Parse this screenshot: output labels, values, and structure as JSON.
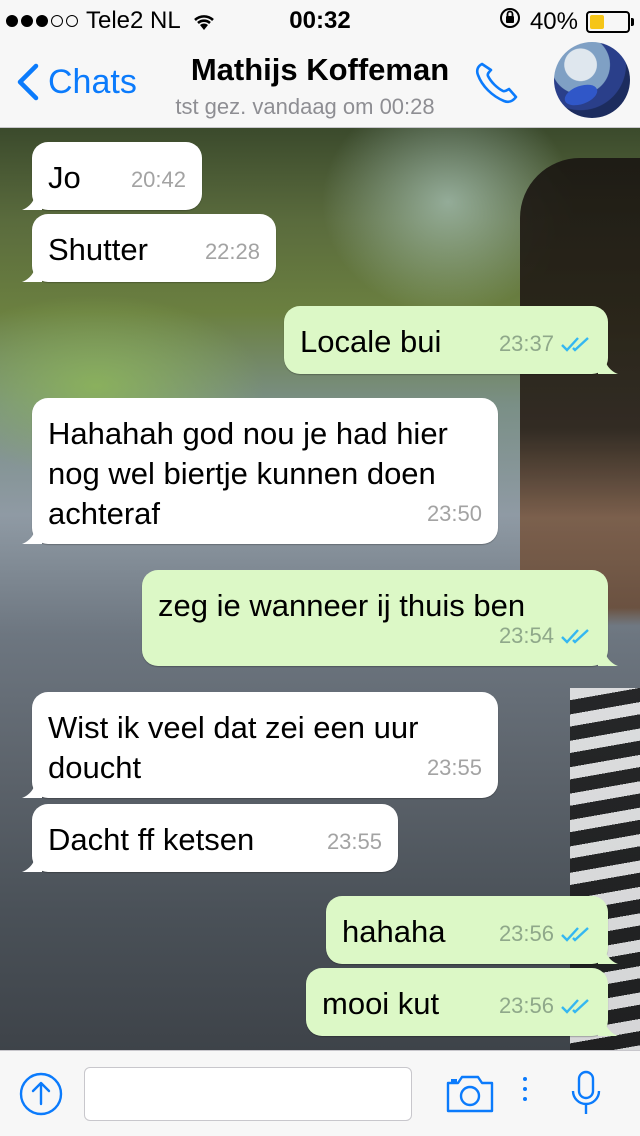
{
  "status_bar": {
    "carrier": "Tele2 NL",
    "signal_dots": 5,
    "signal_filled": 3,
    "time": "00:32",
    "battery_percent": "40%",
    "battery_level": 0.4,
    "icons": [
      "wifi-icon",
      "orientation-lock-icon",
      "battery-icon"
    ]
  },
  "nav": {
    "back_label": "Chats",
    "contact_name": "Mathijs Koffeman",
    "last_seen": "tst gez. vandaag om 00:28",
    "icons": [
      "chevron-left-icon",
      "phone-icon",
      "avatar"
    ]
  },
  "messages": [
    {
      "direction": "in",
      "text": "Jo",
      "time": "20:42"
    },
    {
      "direction": "in",
      "text": "Shutter",
      "time": "22:28"
    },
    {
      "direction": "out",
      "text": "Locale bui",
      "time": "23:37",
      "read": true
    },
    {
      "direction": "in",
      "text": "Hahahah god nou je had hier nog wel biertje kunnen doen achteraf",
      "time": "23:50"
    },
    {
      "direction": "out",
      "text": "zeg ie wanneer ij thuis ben",
      "time": "23:54",
      "read": true
    },
    {
      "direction": "in",
      "text": "Wist ik veel dat zei een uur doucht",
      "time": "23:55"
    },
    {
      "direction": "in",
      "text": "Dacht ff ketsen",
      "time": "23:55"
    },
    {
      "direction": "out",
      "text": "hahaha",
      "time": "23:56",
      "read": true
    },
    {
      "direction": "out",
      "text": "mooi kut",
      "time": "23:56",
      "read": true
    }
  ],
  "input_bar": {
    "message_value": "",
    "placeholder": "",
    "icons": [
      "share-icon",
      "camera-icon",
      "more-icon",
      "microphone-icon"
    ]
  },
  "colors": {
    "accent": "#0b7bfc",
    "incoming_bubble": "#ffffff",
    "outgoing_bubble": "#dcf8c6",
    "read_ticks": "#34b7f1",
    "battery": "#f5c518"
  }
}
